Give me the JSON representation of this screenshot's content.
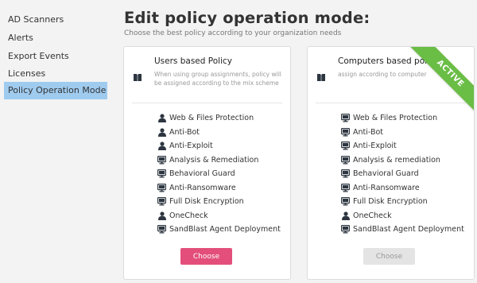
{
  "sidebar": {
    "items": [
      {
        "label": "AD Scanners",
        "active": false
      },
      {
        "label": "Alerts",
        "active": false
      },
      {
        "label": "Export Events",
        "active": false
      },
      {
        "label": "Licenses",
        "active": false
      },
      {
        "label": "Policy Operation Mode",
        "active": true
      }
    ]
  },
  "header": {
    "title": "Edit policy operation mode:",
    "subtitle": "Choose the best policy according to your organization needs"
  },
  "cards": [
    {
      "title": "Users based Policy",
      "description": "When using group assignments, policy will be assigned according to the mix scheme",
      "choose_label": "Choose",
      "choose_enabled": true,
      "active": false,
      "features": [
        {
          "label": "Web & Files Protection",
          "icon": "user-icon"
        },
        {
          "label": "Anti-Bot",
          "icon": "user-icon"
        },
        {
          "label": "Anti-Exploit",
          "icon": "user-icon"
        },
        {
          "label": "Analysis & Remediation",
          "icon": "computer-icon"
        },
        {
          "label": "Behavioral Guard",
          "icon": "computer-icon"
        },
        {
          "label": "Anti-Ransomware",
          "icon": "computer-icon"
        },
        {
          "label": "Full Disk Encryption",
          "icon": "computer-icon"
        },
        {
          "label": "OneCheck",
          "icon": "user-icon"
        },
        {
          "label": "SandBlast Agent Deployment",
          "icon": "computer-icon"
        }
      ]
    },
    {
      "title": "Computers based policy",
      "description": "assign according to computer",
      "choose_label": "Choose",
      "choose_enabled": false,
      "active": true,
      "ribbon_label": "ACTIVE",
      "features": [
        {
          "label": "Web & Files Protection",
          "icon": "computer-icon"
        },
        {
          "label": "Anti-Bot",
          "icon": "computer-icon"
        },
        {
          "label": "Anti-Exploit",
          "icon": "computer-icon"
        },
        {
          "label": "Analysis & remediation",
          "icon": "computer-icon"
        },
        {
          "label": "Behavioral Guard",
          "icon": "computer-icon"
        },
        {
          "label": "Anti-Ransomware",
          "icon": "computer-icon"
        },
        {
          "label": "Full Disk Encryption",
          "icon": "computer-icon"
        },
        {
          "label": "OneCheck",
          "icon": "user-icon"
        },
        {
          "label": "SandBlast Agent Deployment",
          "icon": "computer-icon"
        }
      ]
    }
  ],
  "colors": {
    "accent_pink": "#e34f7a",
    "active_green": "#6abd45",
    "sidebar_active": "#9fcbef",
    "icon_dark": "#2d3640"
  }
}
